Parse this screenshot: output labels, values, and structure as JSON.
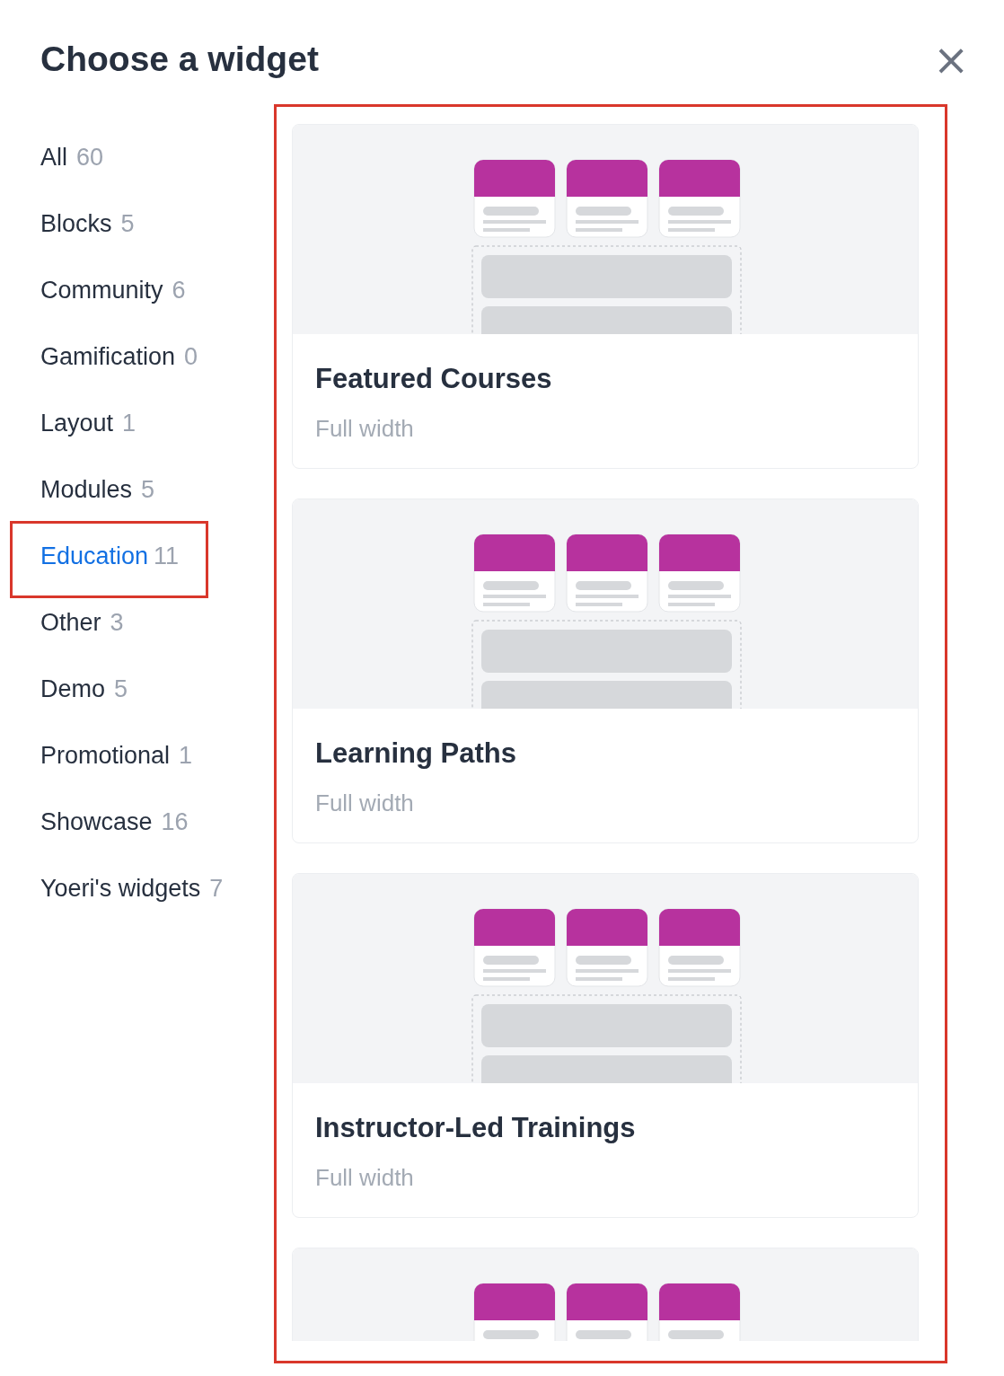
{
  "dialog": {
    "title": "Choose a widget",
    "close": "×"
  },
  "categories": [
    {
      "label": "All",
      "count": "60",
      "selected": false,
      "highlighted": false
    },
    {
      "label": "Blocks",
      "count": "5",
      "selected": false,
      "highlighted": false
    },
    {
      "label": "Community",
      "count": "6",
      "selected": false,
      "highlighted": false
    },
    {
      "label": "Gamification",
      "count": "0",
      "selected": false,
      "highlighted": false
    },
    {
      "label": "Layout",
      "count": "1",
      "selected": false,
      "highlighted": false
    },
    {
      "label": "Modules",
      "count": "5",
      "selected": false,
      "highlighted": false
    },
    {
      "label": "Education",
      "count": "11",
      "selected": true,
      "highlighted": true
    },
    {
      "label": "Other",
      "count": "3",
      "selected": false,
      "highlighted": false
    },
    {
      "label": "Demo",
      "count": "5",
      "selected": false,
      "highlighted": false
    },
    {
      "label": "Promotional",
      "count": "1",
      "selected": false,
      "highlighted": false
    },
    {
      "label": "Showcase",
      "count": "16",
      "selected": false,
      "highlighted": false
    },
    {
      "label": "Yoeri's widgets",
      "count": "7",
      "selected": false,
      "highlighted": false
    }
  ],
  "widget_list": {
    "highlighted": true,
    "cards": [
      {
        "kind": "full",
        "title": "Featured Courses",
        "subtitle": "Full width"
      },
      {
        "kind": "full",
        "title": "Learning Paths",
        "subtitle": "Full width"
      },
      {
        "kind": "full",
        "title": "Instructor-Led Trainings",
        "subtitle": "Full width"
      },
      {
        "kind": "cut_off"
      }
    ]
  }
}
